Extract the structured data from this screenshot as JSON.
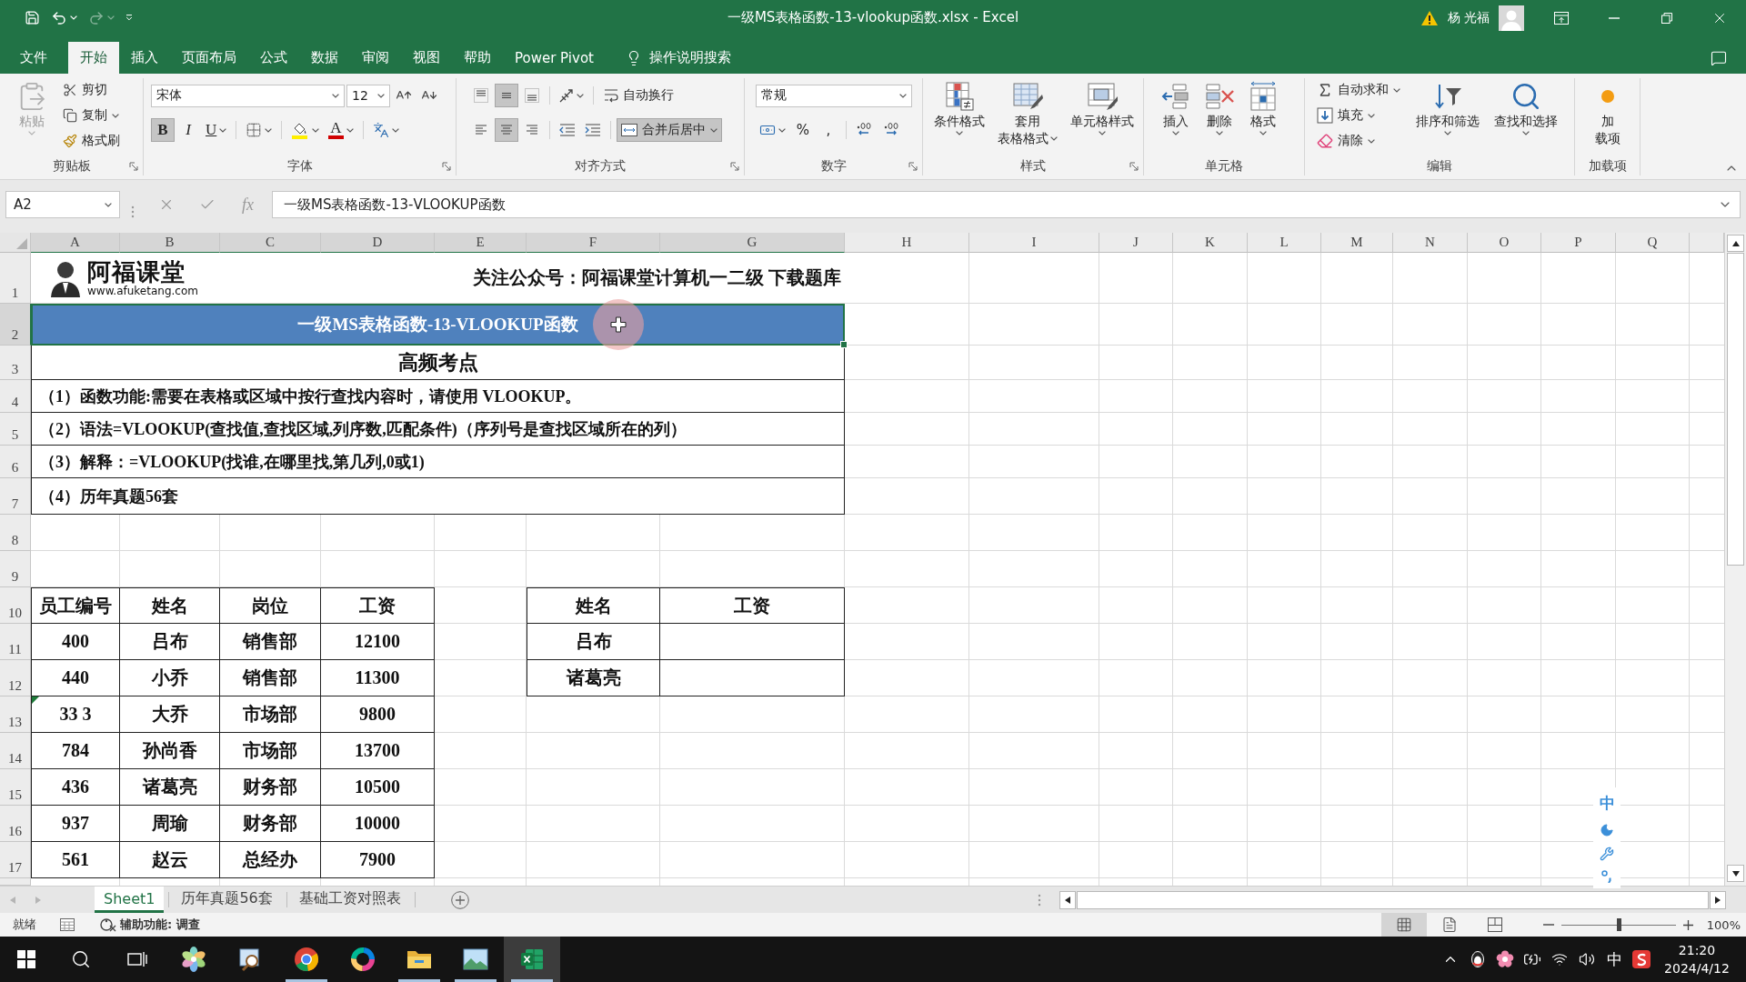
{
  "title_bar": {
    "title": "一级MS表格函数-13-vlookup函数.xlsx - Excel",
    "user": "杨 光福"
  },
  "menu": {
    "tabs": [
      {
        "label": "文件",
        "selected": false
      },
      {
        "label": "开始",
        "selected": true
      },
      {
        "label": "插入",
        "selected": false
      },
      {
        "label": "页面布局",
        "selected": false
      },
      {
        "label": "公式",
        "selected": false
      },
      {
        "label": "数据",
        "selected": false
      },
      {
        "label": "审阅",
        "selected": false
      },
      {
        "label": "视图",
        "selected": false
      },
      {
        "label": "帮助",
        "selected": false
      },
      {
        "label": "Power Pivot",
        "selected": false
      }
    ],
    "tell_me": "操作说明搜索"
  },
  "ribbon": {
    "clipboard": {
      "label": "剪贴板",
      "launcher": true,
      "paste": {
        "label": "粘贴",
        "disabled": true
      },
      "actions": [
        {
          "kind": "cut",
          "label": "剪切"
        },
        {
          "kind": "copy",
          "label": "复制"
        },
        {
          "kind": "format_painter",
          "label": "格式刷"
        }
      ]
    },
    "font": {
      "label": "字体",
      "launcher": true,
      "font_name": "宋体",
      "font_size": "12",
      "toggles": [
        {
          "kind": "bold",
          "label": "B",
          "on": true
        },
        {
          "kind": "italic",
          "label": "I",
          "on": false
        },
        {
          "kind": "underline",
          "label": "U",
          "on": false
        }
      ],
      "font_color": "A"
    },
    "alignment": {
      "label": "对齐方式",
      "launcher": true,
      "vertical": [
        {
          "kind": "top",
          "selected": false
        },
        {
          "kind": "middle",
          "selected": true
        },
        {
          "kind": "bottom",
          "selected": false
        }
      ],
      "horizontal": [
        {
          "kind": "left",
          "selected": false
        },
        {
          "kind": "center",
          "selected": true
        },
        {
          "kind": "right",
          "selected": false
        }
      ],
      "wrap_text": {
        "label": "自动换行",
        "on": false
      },
      "merge": {
        "label": "合并后居中",
        "on": true
      }
    },
    "number": {
      "label": "数字",
      "launcher": true,
      "format": "常规",
      "percent": "%",
      "comma": ","
    },
    "styles": {
      "label": "样式",
      "launcher": true,
      "buttons": [
        {
          "kind": "conditional",
          "lines": [
            "条件格式"
          ]
        },
        {
          "kind": "table",
          "lines": [
            "套用",
            "表格格式"
          ]
        },
        {
          "kind": "cell",
          "lines": [
            "单元格样式"
          ]
        }
      ]
    },
    "cells": {
      "label": "单元格",
      "buttons": [
        {
          "kind": "insert",
          "lines": [
            "插入"
          ]
        },
        {
          "kind": "delete",
          "lines": [
            "删除"
          ]
        },
        {
          "kind": "format",
          "lines": [
            "格式"
          ]
        }
      ]
    },
    "editing": {
      "label": "编辑",
      "small": [
        {
          "kind": "autosum",
          "label": "自动求和"
        },
        {
          "kind": "fill",
          "label": "填充"
        },
        {
          "kind": "clear",
          "label": "清除"
        }
      ],
      "large": [
        {
          "kind": "sort",
          "lines": [
            "排序和筛选"
          ]
        },
        {
          "kind": "find",
          "lines": [
            "查找和选择"
          ]
        }
      ]
    },
    "addins": {
      "label": "加载项",
      "buttons": [
        {
          "kind": "addins",
          "lines": [
            "加",
            "载项"
          ]
        }
      ]
    }
  },
  "formula_bar": {
    "name_box": "A2",
    "function_label": "fx",
    "formula": "一级MS表格函数-13-VLOOKUP函数"
  },
  "sheet": {
    "columns": [
      {
        "label": "A",
        "selected": true
      },
      {
        "label": "B",
        "selected": true
      },
      {
        "label": "C",
        "selected": true
      },
      {
        "label": "D",
        "selected": true
      },
      {
        "label": "E",
        "selected": true
      },
      {
        "label": "F",
        "selected": true
      },
      {
        "label": "G",
        "selected": true
      },
      {
        "label": "H",
        "selected": false
      },
      {
        "label": "I",
        "selected": false
      },
      {
        "label": "J",
        "selected": false
      },
      {
        "label": "K",
        "selected": false
      },
      {
        "label": "L",
        "selected": false
      },
      {
        "label": "M",
        "selected": false
      },
      {
        "label": "N",
        "selected": false
      },
      {
        "label": "O",
        "selected": false
      },
      {
        "label": "P",
        "selected": false
      },
      {
        "label": "Q",
        "selected": false
      }
    ],
    "rows": [
      {
        "label": "1",
        "selected": false
      },
      {
        "label": "2",
        "selected": true
      },
      {
        "label": "3",
        "selected": false
      },
      {
        "label": "4",
        "selected": false
      },
      {
        "label": "5",
        "selected": false
      },
      {
        "label": "6",
        "selected": false
      },
      {
        "label": "7",
        "selected": false
      },
      {
        "label": "8",
        "selected": false
      },
      {
        "label": "9",
        "selected": false
      },
      {
        "label": "10",
        "selected": false
      },
      {
        "label": "11",
        "selected": false
      },
      {
        "label": "12",
        "selected": false
      },
      {
        "label": "13",
        "selected": false
      },
      {
        "label": "14",
        "selected": false
      },
      {
        "label": "15",
        "selected": false
      },
      {
        "label": "16",
        "selected": false
      },
      {
        "label": "17",
        "selected": false
      }
    ],
    "logo": {
      "name": "阿福课堂",
      "url": "www.afuketang.com"
    },
    "notice": "关注公众号：阿福课堂计算机一二级 下载题库",
    "title": {
      "text": "一级MS表格函数-13-VLOOKUP函数",
      "selected": true
    },
    "subtitle": "高频考点",
    "notes": [
      "（1）函数功能:需要在表格或区域中按行查找内容时，请使用 VLOOKUP。",
      "（2）语法=VLOOKUP(查找值,查找区域,列序数,匹配条件)（序列号是查找区域所在的列）",
      "（3）解释：=VLOOKUP(找谁,在哪里找,第几列,0或1)",
      "（4）历年真题56套"
    ],
    "employees": {
      "columns": [
        "员工编号",
        "姓名",
        "岗位",
        "工资"
      ],
      "rows": [
        {
          "cells": [
            "400",
            "吕布",
            "销售部",
            "12100"
          ],
          "warning": false
        },
        {
          "cells": [
            "440",
            "小乔",
            "销售部",
            "11300"
          ],
          "warning": false
        },
        {
          "cells": [
            "33 3",
            "大乔",
            "市场部",
            "9800"
          ],
          "warning": true
        },
        {
          "cells": [
            "784",
            "孙尚香",
            "市场部",
            "13700"
          ],
          "warning": false
        },
        {
          "cells": [
            "436",
            "诸葛亮",
            "财务部",
            "10500"
          ],
          "warning": false
        },
        {
          "cells": [
            "937",
            "周瑜",
            "财务部",
            "10000"
          ],
          "warning": false
        },
        {
          "cells": [
            "561",
            "赵云",
            "总经办",
            "7900"
          ],
          "warning": false
        }
      ]
    },
    "lookup": {
      "columns": [
        "姓名",
        "工资"
      ],
      "rows": [
        {
          "name": "吕布"
        },
        {
          "name": "诸葛亮"
        }
      ]
    }
  },
  "ime_toolbar": {
    "mode": "中"
  },
  "sheet_tabs": [
    {
      "label": "Sheet1",
      "selected": true
    },
    {
      "label": "历年真题56套",
      "selected": false
    },
    {
      "label": "基础工资对照表",
      "selected": false
    }
  ],
  "status_bar": {
    "status": "就绪",
    "accessibility": "辅助功能: 调查",
    "views": [
      {
        "kind": "normal",
        "selected": true
      },
      {
        "kind": "page_layout",
        "selected": false
      },
      {
        "kind": "page_break",
        "selected": false
      }
    ],
    "zoom": {
      "level": 0.5,
      "reading": "100%"
    }
  },
  "taskbar": {
    "apps": [
      {
        "kind": "pinwheel",
        "running": false,
        "selected": false
      },
      {
        "kind": "magnifier",
        "running": false,
        "selected": false
      },
      {
        "kind": "browser",
        "running": true,
        "selected": false
      },
      {
        "kind": "color_ring",
        "running": false,
        "selected": false
      },
      {
        "kind": "folder",
        "running": true,
        "selected": false
      },
      {
        "kind": "picture",
        "running": true,
        "selected": false
      },
      {
        "kind": "spreadsheet",
        "running": true,
        "selected": true
      }
    ],
    "ime": "中",
    "time": "21:20",
    "date": "2024/4/12"
  }
}
